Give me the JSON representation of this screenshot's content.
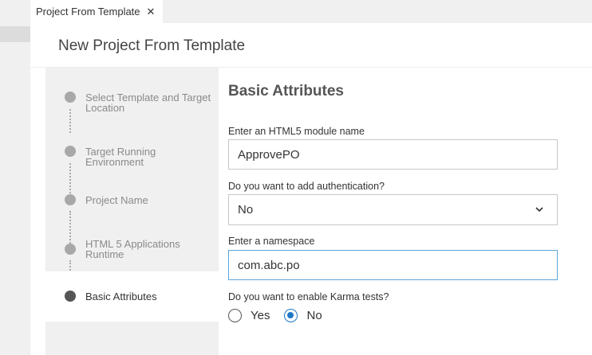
{
  "tab": {
    "title": "Project From Template",
    "close": "✕"
  },
  "page": {
    "title": "New Project From Template"
  },
  "steps": [
    {
      "label": "Select Template and Target Location",
      "active": false
    },
    {
      "label": "Target Running Environment",
      "active": false
    },
    {
      "label": "Project Name",
      "active": false
    },
    {
      "label": "HTML 5 Applications Runtime",
      "active": false
    },
    {
      "label": "Basic Attributes",
      "active": true
    }
  ],
  "form": {
    "section_title": "Basic Attributes",
    "module_label": "Enter an HTML5 module name",
    "module_value": "ApprovePO",
    "auth_label": "Do you want to add authentication?",
    "auth_value": "No",
    "namespace_label": "Enter a namespace",
    "namespace_value": "com.abc.po",
    "karma_label": "Do you want to enable Karma tests?",
    "karma_options": [
      {
        "label": "Yes",
        "checked": false
      },
      {
        "label": "No",
        "checked": true
      }
    ]
  },
  "colors": {
    "accent": "#1f78c8",
    "focus_border": "#5aa7dd",
    "step_panel": "#f0f0f0"
  }
}
